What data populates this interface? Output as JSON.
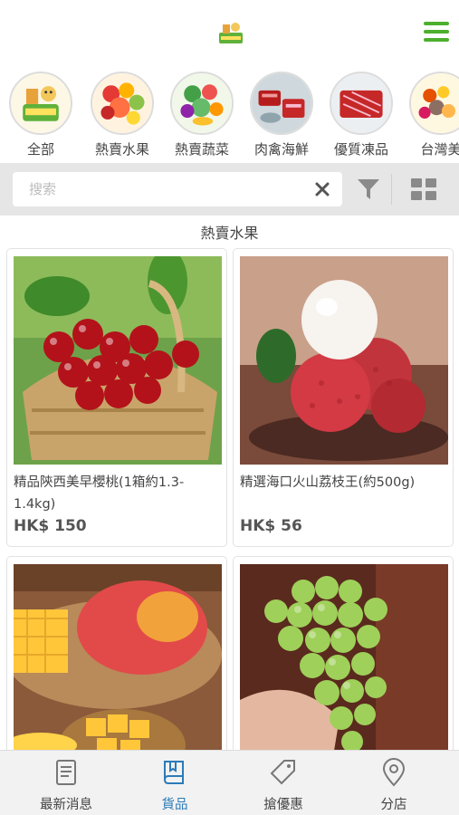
{
  "header": {
    "logo_icon": "farm-logo-icon",
    "menu_icon": "hamburger-menu-icon",
    "accent_color": "#4caf2e"
  },
  "categories": [
    {
      "label": "全部",
      "icon": "farm-logo-icon"
    },
    {
      "label": "熱賣水果",
      "icon": "fruit-icon"
    },
    {
      "label": "熱賣蔬菜",
      "icon": "vegetable-icon"
    },
    {
      "label": "肉禽海鮮",
      "icon": "meat-seafood-icon"
    },
    {
      "label": "優質凍品",
      "icon": "frozen-meat-icon"
    },
    {
      "label": "台灣美",
      "icon": "taiwan-food-icon"
    }
  ],
  "search": {
    "placeholder": "搜索",
    "clear_icon": "close-icon",
    "filter_icon": "filter-icon",
    "view_icon": "grid-view-icon"
  },
  "section": {
    "title": "熱賣水果"
  },
  "products": [
    {
      "name": "精品陝西美早櫻桃(1箱約1.3-1.4kg)",
      "price": "HK$ 150",
      "image": "cherries"
    },
    {
      "name": "精選海口火山荔枝王(約500g)",
      "price": "HK$ 56",
      "image": "lychee"
    },
    {
      "name": "",
      "price": "",
      "image": "mango"
    },
    {
      "name": "",
      "price": "",
      "image": "grapes"
    }
  ],
  "bottom_nav": [
    {
      "label": "最新消息",
      "icon": "news-icon",
      "active": false
    },
    {
      "label": "貨品",
      "icon": "book-icon",
      "active": true
    },
    {
      "label": "搶優惠",
      "icon": "tag-icon",
      "active": false
    },
    {
      "label": "分店",
      "icon": "location-pin-icon",
      "active": false
    }
  ],
  "colors": {
    "active_nav": "#2b7bb9",
    "inactive_nav": "#777777"
  }
}
